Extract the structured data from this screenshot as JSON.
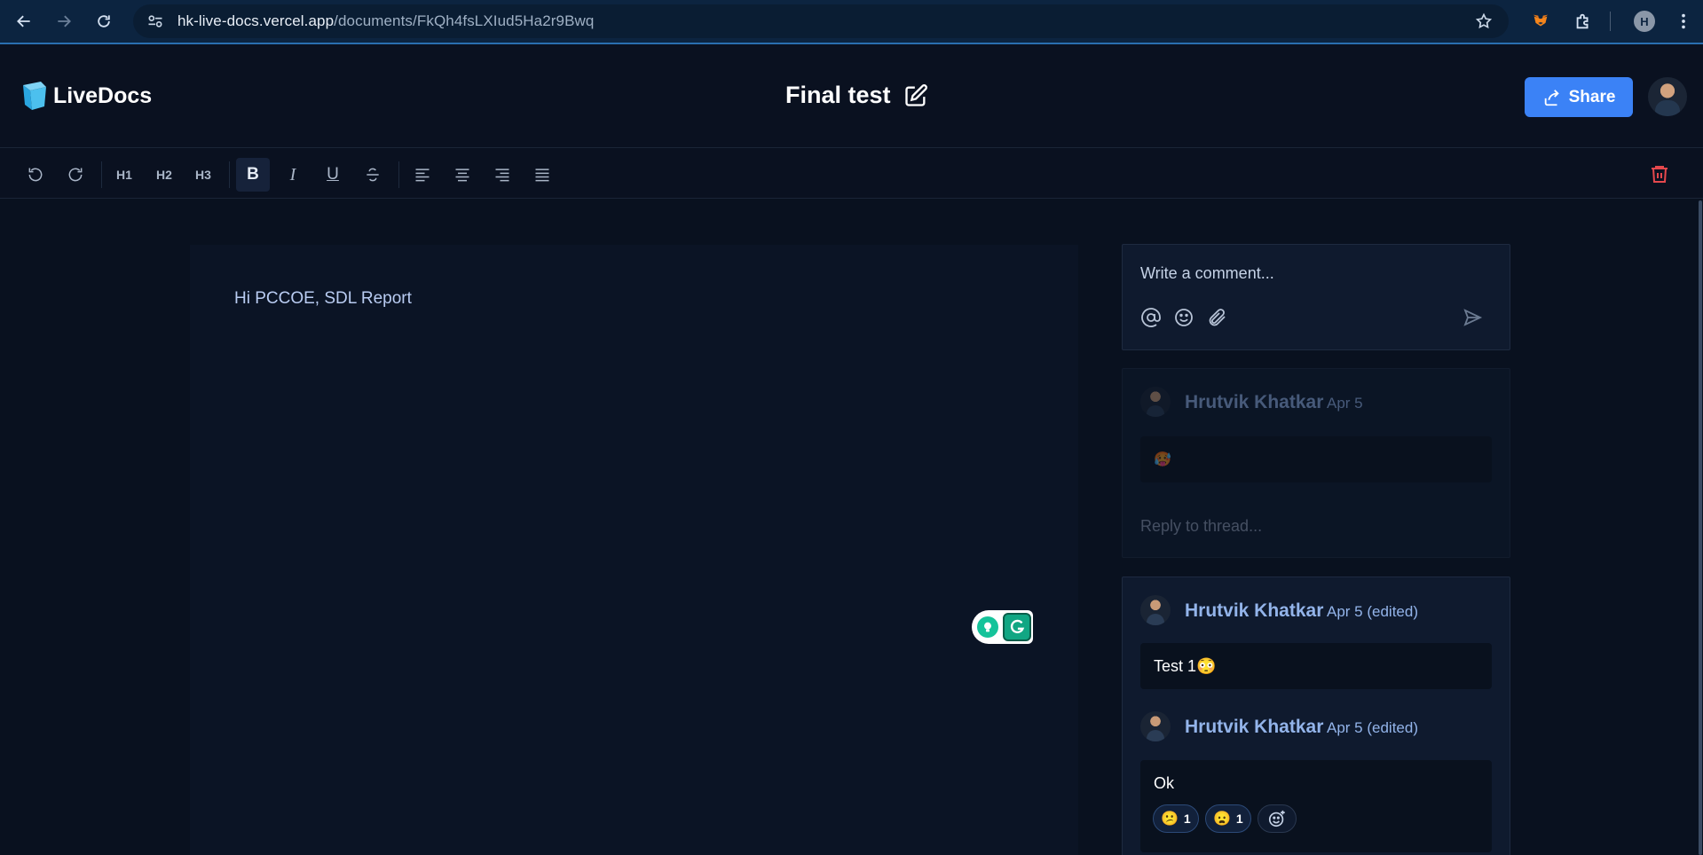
{
  "browser": {
    "url_domain": "hk-live-docs.vercel.app",
    "url_path": "/documents/FkQh4fsLXIud5Ha2r9Bwq",
    "profile_initial": "H"
  },
  "app": {
    "logo_text": "LiveDocs",
    "doc_title": "Final test",
    "share_label": "Share"
  },
  "toolbar": {
    "h1": "H1",
    "h2": "H2",
    "h3": "H3",
    "bold": "B",
    "italic": "I",
    "underline": "U"
  },
  "editor": {
    "content": "Hi PCCOE, SDL Report"
  },
  "comments": {
    "composer_placeholder": "Write a comment...",
    "threads": [
      {
        "author": "Hrutvik Khatkar",
        "date": "Apr 5",
        "body": "🥵",
        "reply_placeholder": "Reply to thread..."
      },
      {
        "messages": [
          {
            "author": "Hrutvik Khatkar",
            "date": "Apr 5 (edited)",
            "body": "Test 1😳"
          },
          {
            "author": "Hrutvik Khatkar",
            "date": "Apr 5 (edited)",
            "body": "Ok",
            "reactions": [
              {
                "emoji": "😕",
                "count": "1"
              },
              {
                "emoji": "😦",
                "count": "1"
              }
            ]
          }
        ]
      }
    ]
  },
  "colors": {
    "accent": "#3b82f6",
    "danger": "#e5484d",
    "background": "#09111f"
  }
}
